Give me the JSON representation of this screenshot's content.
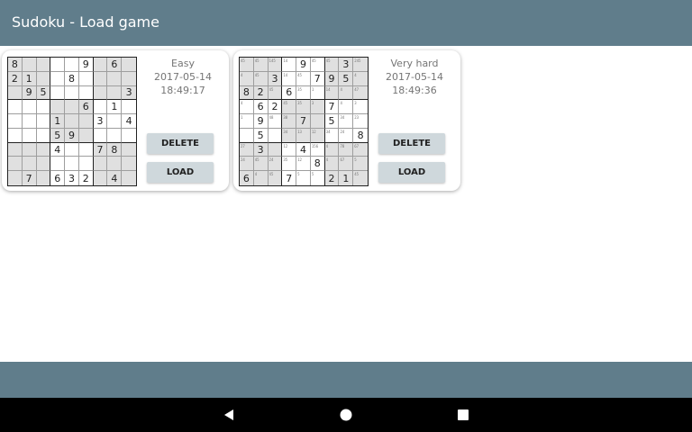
{
  "app": {
    "title": "Sudoku - Load game"
  },
  "games": [
    {
      "difficulty": "Easy",
      "date": "2017-05-14",
      "time": "18:49:17",
      "delete_label": "DELETE",
      "load_label": "LOAD",
      "board": [
        [
          "8",
          "",
          "",
          "",
          "",
          "9",
          "",
          "6",
          ""
        ],
        [
          "2",
          "1",
          "",
          "",
          "8",
          "",
          "",
          "",
          ""
        ],
        [
          "",
          "9",
          "5",
          "",
          "",
          "",
          "",
          "",
          "3"
        ],
        [
          "",
          "",
          "",
          "",
          "",
          "6",
          "",
          "1",
          ""
        ],
        [
          "",
          "",
          "",
          "1",
          "",
          "",
          "3",
          "",
          "4"
        ],
        [
          "",
          "",
          "",
          "5",
          "9",
          "",
          "",
          "",
          ""
        ],
        [
          "",
          "",
          "",
          "4",
          "",
          "",
          "7",
          "8",
          ""
        ],
        [
          "",
          "",
          "",
          "",
          "",
          "",
          "",
          "",
          ""
        ],
        [
          "",
          "7",
          "",
          "6",
          "3",
          "2",
          "",
          "4",
          ""
        ]
      ],
      "shaded": [
        [
          1,
          1,
          1,
          0,
          0,
          0,
          1,
          1,
          1
        ],
        [
          1,
          1,
          1,
          0,
          0,
          0,
          1,
          1,
          1
        ],
        [
          1,
          1,
          1,
          0,
          0,
          0,
          1,
          1,
          1
        ],
        [
          0,
          0,
          0,
          1,
          1,
          1,
          0,
          0,
          0
        ],
        [
          0,
          0,
          0,
          1,
          1,
          1,
          0,
          0,
          0
        ],
        [
          0,
          0,
          0,
          1,
          1,
          1,
          0,
          0,
          0
        ],
        [
          1,
          1,
          1,
          0,
          0,
          0,
          1,
          1,
          1
        ],
        [
          1,
          1,
          1,
          0,
          0,
          0,
          1,
          1,
          1
        ],
        [
          1,
          1,
          1,
          0,
          0,
          0,
          1,
          1,
          1
        ]
      ]
    },
    {
      "difficulty": "Very hard",
      "date": "2017-05-14",
      "time": "18:49:36",
      "delete_label": "DELETE",
      "load_label": "LOAD",
      "board": [
        [
          "",
          "",
          "",
          "",
          "9",
          "",
          "",
          "3",
          ""
        ],
        [
          "",
          "",
          "3",
          "",
          "",
          "7",
          "9",
          "5",
          ""
        ],
        [
          "8",
          "2",
          "",
          "6",
          "",
          "",
          "",
          "",
          ""
        ],
        [
          "",
          "6",
          "2",
          "",
          "",
          "",
          "7",
          "",
          ""
        ],
        [
          "",
          "9",
          "",
          "",
          "7",
          "",
          "5",
          "",
          ""
        ],
        [
          "",
          "5",
          "",
          "",
          "",
          "",
          "",
          "",
          "8"
        ],
        [
          "",
          "3",
          "",
          "",
          "4",
          "",
          "",
          "",
          ""
        ],
        [
          "",
          "",
          "",
          "",
          "",
          "8",
          "",
          "",
          ""
        ],
        [
          "6",
          "",
          "",
          "7",
          "",
          "",
          "2",
          "1",
          ""
        ]
      ],
      "shaded": [
        [
          1,
          1,
          1,
          0,
          0,
          0,
          1,
          1,
          1
        ],
        [
          1,
          1,
          1,
          0,
          0,
          0,
          1,
          1,
          1
        ],
        [
          1,
          1,
          1,
          0,
          0,
          0,
          1,
          1,
          1
        ],
        [
          0,
          0,
          0,
          1,
          1,
          1,
          0,
          0,
          0
        ],
        [
          0,
          0,
          0,
          1,
          1,
          1,
          0,
          0,
          0
        ],
        [
          0,
          0,
          0,
          1,
          1,
          1,
          0,
          0,
          0
        ],
        [
          1,
          1,
          1,
          0,
          0,
          0,
          1,
          1,
          1
        ],
        [
          1,
          1,
          1,
          0,
          0,
          0,
          1,
          1,
          1
        ],
        [
          1,
          1,
          1,
          0,
          0,
          0,
          1,
          1,
          1
        ]
      ],
      "notes": [
        [
          "45",
          "45",
          "145",
          "14",
          "",
          "45",
          "45",
          "",
          "245"
        ],
        [
          "4",
          "45",
          "",
          "14",
          "45",
          "",
          "",
          "",
          "4"
        ],
        [
          "",
          "",
          "45",
          "",
          "35",
          "1",
          "14",
          "4",
          "47"
        ],
        [
          "4",
          "",
          "",
          "45",
          "35",
          "3",
          "",
          "4",
          "3"
        ],
        [
          "1",
          "",
          "48",
          "38",
          "",
          "",
          "",
          "34",
          "23"
        ],
        [
          "",
          "",
          "",
          "34",
          "13",
          "12",
          "34",
          "24",
          ""
        ],
        [
          "27",
          "",
          "",
          "12",
          "",
          "156",
          "4",
          "78",
          "67"
        ],
        [
          "24",
          "45",
          "24",
          "35",
          "12",
          "",
          "4",
          "67",
          "5"
        ],
        [
          "",
          "4",
          "45",
          "",
          "5",
          "5",
          "",
          "",
          "45"
        ]
      ]
    }
  ],
  "nav": {
    "back": "back-icon",
    "home": "home-icon",
    "recent": "recent-apps-icon"
  }
}
